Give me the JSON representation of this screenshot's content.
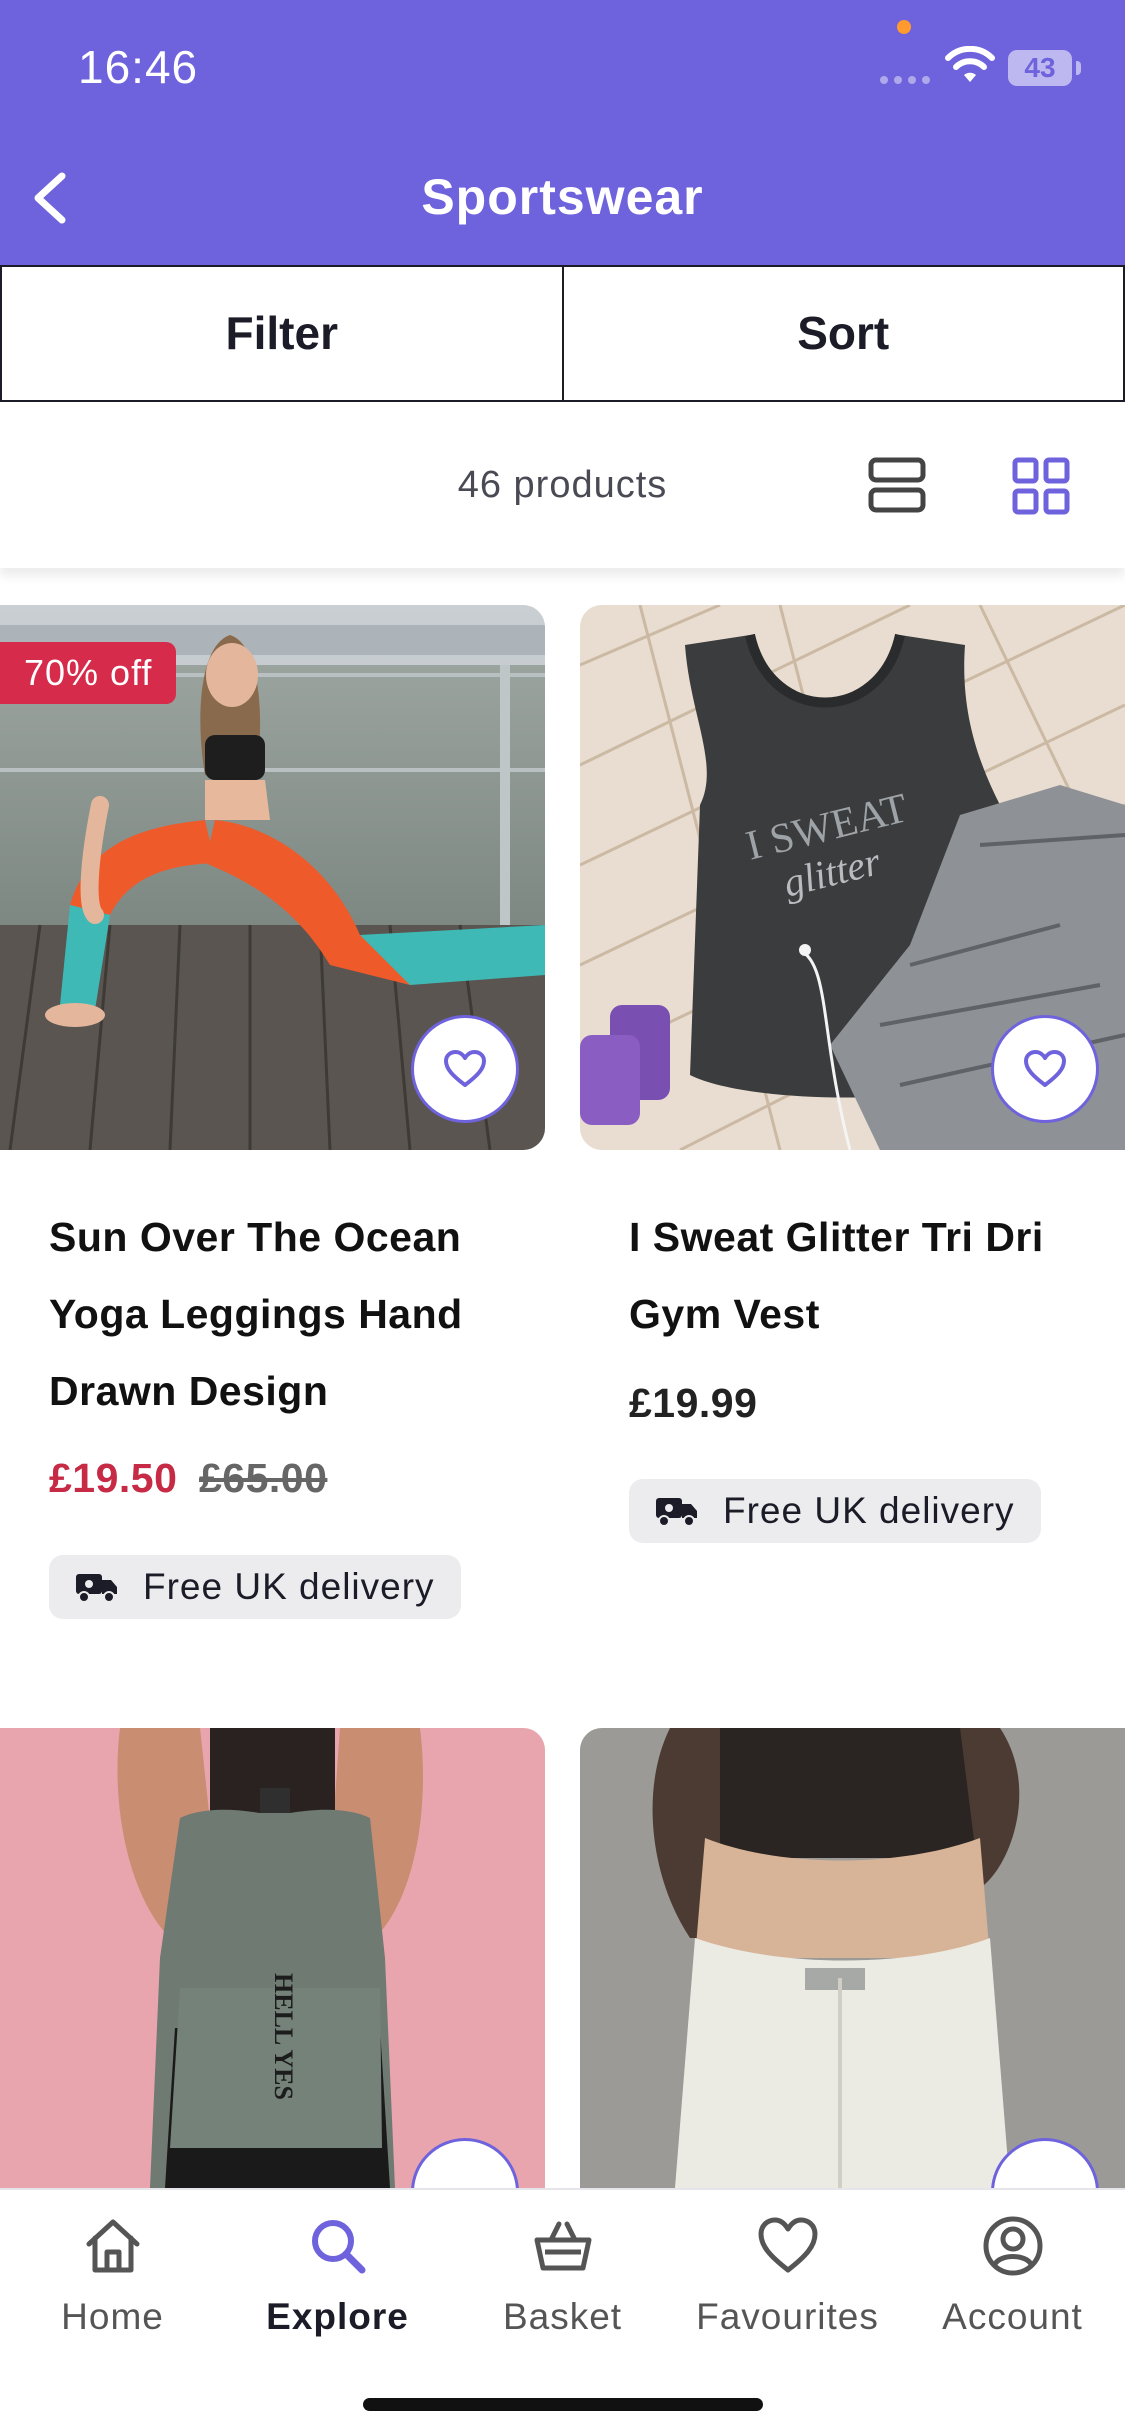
{
  "status_bar": {
    "time": "16:46",
    "battery": "43"
  },
  "header": {
    "title": "Sportswear"
  },
  "toolbar": {
    "filter_label": "Filter",
    "sort_label": "Sort"
  },
  "results": {
    "count_text": "46 products"
  },
  "products": [
    {
      "name": "Sun Over The Ocean Yoga Leggings Hand Drawn Design",
      "sale_price": "£19.50",
      "original_price": "£65.00",
      "discount_badge": "70% off",
      "delivery": "Free UK delivery"
    },
    {
      "name": "I Sweat Glitter Tri Dri Gym Vest",
      "price": "£19.99",
      "delivery": "Free UK delivery",
      "print_text": "I SWEAT glitter"
    },
    {
      "print_text": "HELL YES"
    }
  ],
  "bottom_nav": [
    {
      "label": "Home",
      "icon": "home-icon"
    },
    {
      "label": "Explore",
      "icon": "search-icon",
      "active": true
    },
    {
      "label": "Basket",
      "icon": "basket-icon"
    },
    {
      "label": "Favourites",
      "icon": "heart-icon"
    },
    {
      "label": "Account",
      "icon": "account-icon"
    }
  ],
  "colors": {
    "brand": "#6e63dc",
    "sale": "#c62a45",
    "badge": "#d62b4b"
  }
}
